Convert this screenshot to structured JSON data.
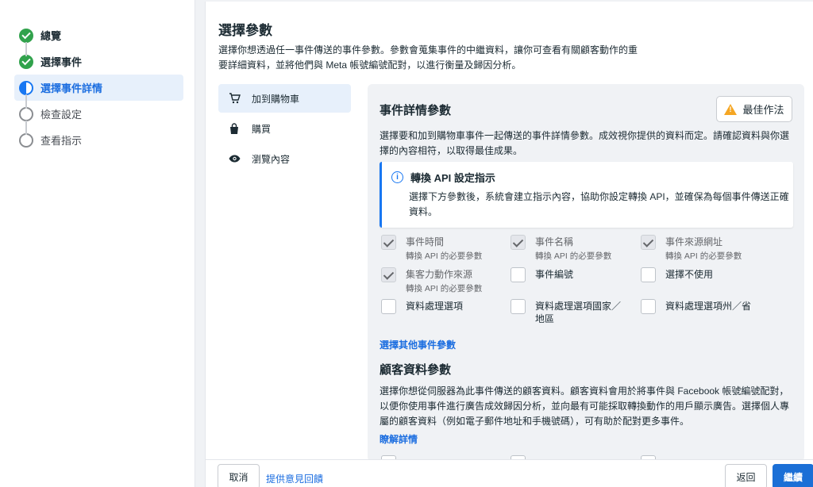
{
  "steps": [
    {
      "label": "總覽",
      "state": "done"
    },
    {
      "label": "選擇事件",
      "state": "done"
    },
    {
      "label": "選擇事件詳情",
      "state": "current"
    },
    {
      "label": "檢查設定",
      "state": "todo"
    },
    {
      "label": "查看指示",
      "state": "todo"
    }
  ],
  "page": {
    "title": "選擇參數",
    "desc": "選擇你想透過任一事件傳送的事件參數。參數會蒐集事件的中繼資料，讓你可查看有關顧客動作的重要詳細資料，並將他們與 Meta 帳號編號配對，以進行衡量及歸因分析。"
  },
  "event_tabs": [
    {
      "label": "加到購物車",
      "icon": "cart-icon"
    },
    {
      "label": "購買",
      "icon": "shopping-bag-icon"
    },
    {
      "label": "瀏覽內容",
      "icon": "eye-icon"
    }
  ],
  "event_details": {
    "title": "事件詳情參數",
    "best_practice_label": "最佳作法",
    "desc": "選擇要和加到購物車事件一起傳送的事件詳情參數。成效視你提供的資料而定。請確認資料與你選擇的內容相符，以取得最佳成果。",
    "info_title": "轉換 API 設定指示",
    "info_text": "選擇下方參數後，系統會建立指示內容，協助你設定轉換 API，並確保為每個事件傳送正確資料。",
    "params": [
      {
        "name": "事件時間",
        "sub": "轉換 API 的必要參數",
        "checked": true,
        "disabled": true
      },
      {
        "name": "事件名稱",
        "sub": "轉換 API 的必要參數",
        "checked": true,
        "disabled": true
      },
      {
        "name": "事件來源網址",
        "sub": "轉換 API 的必要參數",
        "checked": true,
        "disabled": true
      },
      {
        "name": "集客力動作來源",
        "sub": "轉換 API 的必要參數",
        "checked": true,
        "disabled": true
      },
      {
        "name": "事件編號",
        "sub": "",
        "checked": false,
        "disabled": false
      },
      {
        "name": "選擇不使用",
        "sub": "",
        "checked": false,
        "disabled": false
      },
      {
        "name": "資料處理選項",
        "sub": "",
        "checked": false,
        "disabled": false
      },
      {
        "name": "資料處理選項國家／地區",
        "sub": "",
        "checked": false,
        "disabled": false
      },
      {
        "name": "資料處理選項州／省",
        "sub": "",
        "checked": false,
        "disabled": false
      }
    ],
    "more_link": "選擇其他事件參數"
  },
  "customer_info": {
    "title": "顧客資料參數",
    "desc": "選擇你想從伺服器為此事件傳送的顧客資料。顧客資料會用於將事件與 Facebook 帳號編號配對，以便你使用事件進行廣告成效歸因分析，並向最有可能採取轉換動作的用戶顯示廣告。選擇個人專屬的顧客資料（例如電子郵件地址和手機號碼），可有助於配對更多事件。",
    "learn_more": "瞭解詳情"
  },
  "footer": {
    "cancel": "取消",
    "feedback": "提供意見回饋",
    "back": "返回",
    "continue": "繼續"
  },
  "colors": {
    "accent": "#1877f2",
    "done": "#31a24c",
    "warning": "#f5a623"
  }
}
